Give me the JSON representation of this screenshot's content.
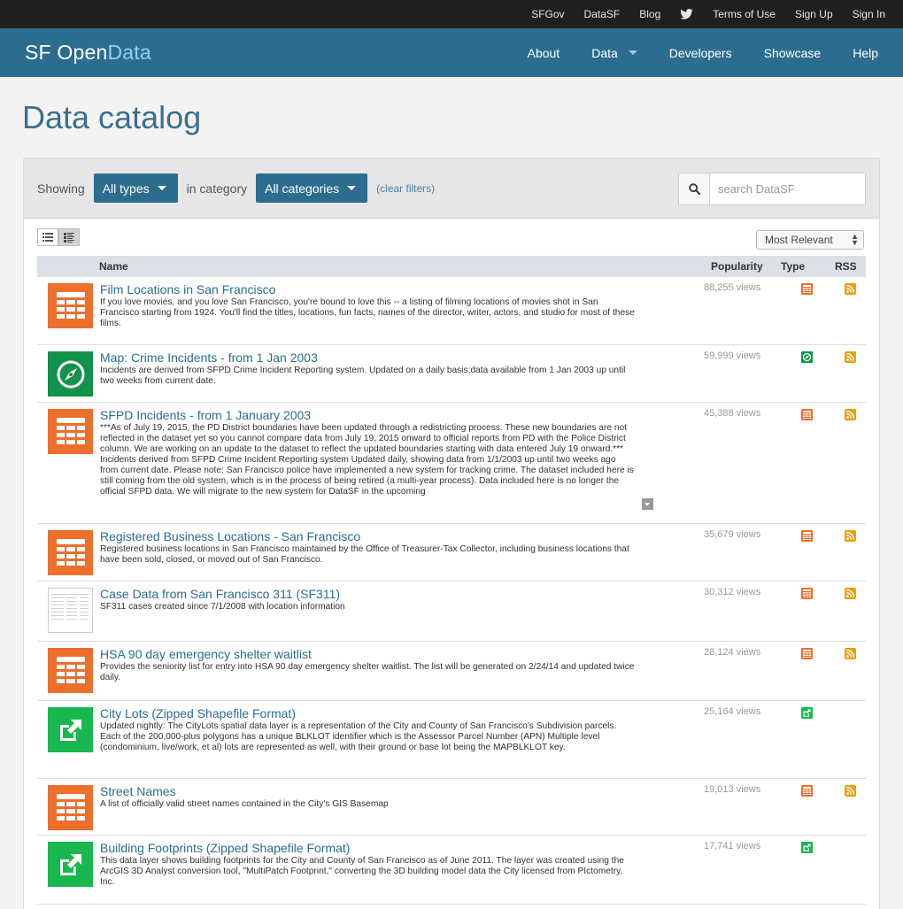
{
  "topbar": {
    "links": [
      "SFGov",
      "DataSF",
      "Blog"
    ],
    "twitter_icon": "twitter-icon",
    "links_right": [
      "Terms of Use",
      "Sign Up",
      "Sign In"
    ]
  },
  "navbar": {
    "brand_part1": "SF Open",
    "brand_part2": "Data",
    "items": [
      "About",
      "Data",
      "Developers",
      "Showcase",
      "Help"
    ]
  },
  "page": {
    "title": "Data catalog"
  },
  "filters": {
    "showing_label": "Showing",
    "type_value": "All types",
    "category_label": "in category",
    "category_value": "All categories",
    "clear_label": "(clear filters)",
    "search_placeholder": "search DataSF"
  },
  "sort": {
    "selected": "Most Relevant"
  },
  "table": {
    "headers": {
      "name": "Name",
      "popularity": "Popularity",
      "type": "Type",
      "rss": "RSS"
    },
    "rows": [
      {
        "title": "Film Locations in San Francisco",
        "description": "If you love movies, and you love San Francisco, you're bound to love this -- a listing of filming locations of movies shot in San Francisco starting from 1924. You'll find the titles, locations, fun facts, names of the director, writer, actors, and studio for most of these films.",
        "views": "88,255 views",
        "icon": "table-icon",
        "type": "table",
        "rss": true
      },
      {
        "title": "Map: Crime Incidents - from 1 Jan 2003",
        "description": "Incidents are derived from SFPD Crime Incident Reporting system. Updated on a daily basis;data available from 1 Jan 2003 up until two weeks from current date.",
        "views": "59,999 views",
        "icon": "compass-icon",
        "type": "map",
        "rss": true
      },
      {
        "title": "SFPD Incidents - from 1 January 2003",
        "description": "***As of July 19, 2015, the PD District boundaries have been updated through a redistricting process. These new boundaries are not reflected in the dataset yet so you cannot compare data from July 19, 2015 onward to official reports from PD with the Police District column. We are working on an update to the dataset to reflect the updated boundaries starting with data entered July 19 onward.*** Incidents derived from SFPD Crime Incident Reporting system Updated daily, showing data from 1/1/2003 up until two weeks ago from current date. Please note: San Francisco police have implemented a new system for tracking crime. The dataset included here is still coming from the old system, which is in the process of being retired (a multi-year process). Data included here is no longer the official SFPD data. We will migrate to the new system for DataSF in the upcoming",
        "views": "45,388 views",
        "icon": "table-icon",
        "type": "table",
        "rss": true
      },
      {
        "title": "Registered Business Locations - San Francisco",
        "description": "Registered business locations in San Francisco maintained by the Office of Treasurer-Tax Collector, including business locations that have been sold, closed, or moved out of San Francisco.",
        "views": "35,679 views",
        "icon": "table-icon",
        "type": "table",
        "rss": true
      },
      {
        "title": "Case Data from San Francisco 311 (SF311)",
        "description": "SF311 cases created since 7/1/2008 with location information",
        "views": "30,312 views",
        "icon": "dataset-thumbnail",
        "type": "table",
        "rss": true
      },
      {
        "title": "HSA 90 day emergency shelter waitlist",
        "description": "Provides the seniority list for entry into HSA 90 day emergency shelter waitlist. The list will be generated on 2/24/14 and updated twice daily.",
        "views": "28,124 views",
        "icon": "table-icon",
        "type": "table",
        "rss": true
      },
      {
        "title": "City Lots (Zipped Shapefile Format)",
        "description": "Updated nightly: The CityLots spatial data layer is a representation of the City and County of San Francisco's Subdivision parcels. Each of the 200,000-plus polygons has a unique BLKLOT identifier which is the Assessor Parcel Number (APN) Multiple level (condominium, live/work, et al) lots are represented as well, with their ground or base lot being the MAPBLKLOT key.",
        "views": "25,164 views",
        "icon": "external-link-icon",
        "type": "external",
        "rss": false
      },
      {
        "title": "Street Names",
        "description": "A list of officially valid street names contained in the City's GIS Basemap",
        "views": "19,013 views",
        "icon": "table-icon",
        "type": "table",
        "rss": true
      },
      {
        "title": "Building Footprints (Zipped Shapefile Format)",
        "description": "This data layer shows building footprints for the City and County of San Francisco as of June 2011. The layer was created using the ArcGIS 3D Analyst conversion tool, \"MultiPatch Footprint,\" converting the 3D building model data the City licensed from PIctometry, Inc.",
        "views": "17,741 views",
        "icon": "external-link-icon",
        "type": "external",
        "rss": false
      }
    ]
  },
  "colors": {
    "brand": "#2c6d8f",
    "table_orange": "#ec6f2c",
    "map_green": "#12924a",
    "external_green": "#19b84f",
    "rss_orange": "#f0a010"
  }
}
